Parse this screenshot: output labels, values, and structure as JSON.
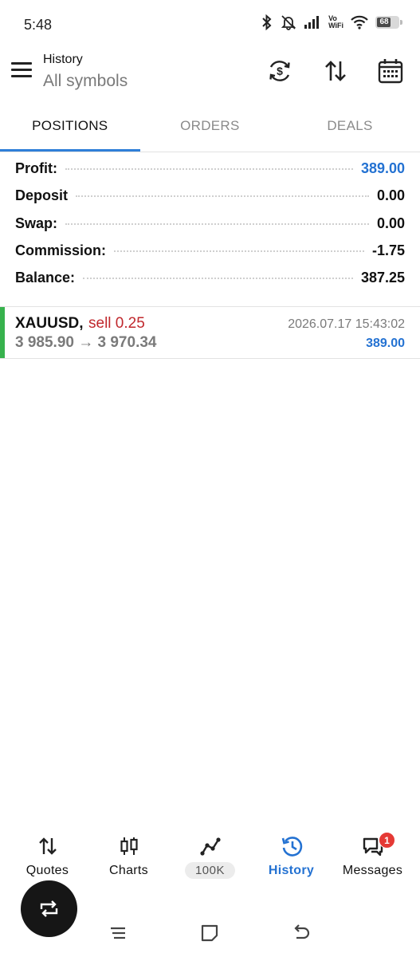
{
  "status_bar": {
    "time": "5:48",
    "vowifi_line1": "Vo",
    "vowifi_line2": "WiFi",
    "battery": "68"
  },
  "header": {
    "title": "History",
    "subtitle": "All symbols",
    "icons": [
      "menu-icon",
      "currency-refresh-icon",
      "sort-icon",
      "calendar-icon"
    ]
  },
  "tabs": [
    {
      "label": "POSITIONS",
      "active": true
    },
    {
      "label": "ORDERS",
      "active": false
    },
    {
      "label": "DEALS",
      "active": false
    }
  ],
  "summary": [
    {
      "label": "Profit:",
      "value": "389.00",
      "color": "#2472d2"
    },
    {
      "label": "Deposit",
      "value": "0.00"
    },
    {
      "label": "Swap:",
      "value": "0.00"
    },
    {
      "label": "Commission:",
      "value": "-1.75"
    },
    {
      "label": "Balance:",
      "value": "387.25"
    }
  ],
  "positions": [
    {
      "symbol": "XAUUSD,",
      "side": "sell 0.25",
      "prices": "3 985.90 → 3 970.34",
      "time": "2026.07.17 15:43:02",
      "profit": "389.00"
    }
  ],
  "bottom_nav": {
    "items": [
      {
        "label": "Quotes",
        "icon": "quotes-arrows-icon"
      },
      {
        "label": "Charts",
        "icon": "candlestick-icon"
      },
      {
        "label": "100K",
        "icon": "trade-line-icon"
      },
      {
        "label": "History",
        "icon": "history-clock-icon",
        "active": true
      },
      {
        "label": "Messages",
        "icon": "messages-icon",
        "badge": "1"
      }
    ]
  },
  "colors": {
    "accent": "#2f7fd8",
    "profit_blue": "#2472d2",
    "sell_red": "#c0282d",
    "position_marker": "#37b24d",
    "badge_red": "#e53935"
  }
}
